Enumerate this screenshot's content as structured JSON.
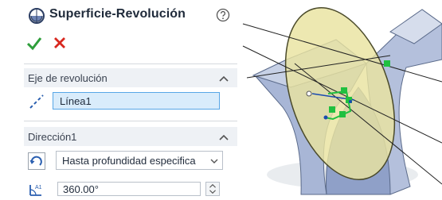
{
  "panel": {
    "title": "Superficie-Revolución",
    "help_icon": "help-circle-icon",
    "accept_icon": "checkmark-icon",
    "cancel_icon": "close-icon"
  },
  "axis_section": {
    "title": "Eje de revolución",
    "value": "Línea1"
  },
  "direction_section": {
    "title": "Dirección1",
    "end_condition": "Hasta profundidad especifica",
    "angle": "360.00°"
  },
  "colors": {
    "accept_green": "#2e9e3a",
    "cancel_red": "#d8281f",
    "field_selected_bg": "#d9ecfb",
    "field_selected_border": "#57a6e6",
    "section_bg": "#eef1f5",
    "part_blue": "#a8b6d6",
    "surface_yellow": "#e9e3a0",
    "sketch_green": "#20c040"
  }
}
